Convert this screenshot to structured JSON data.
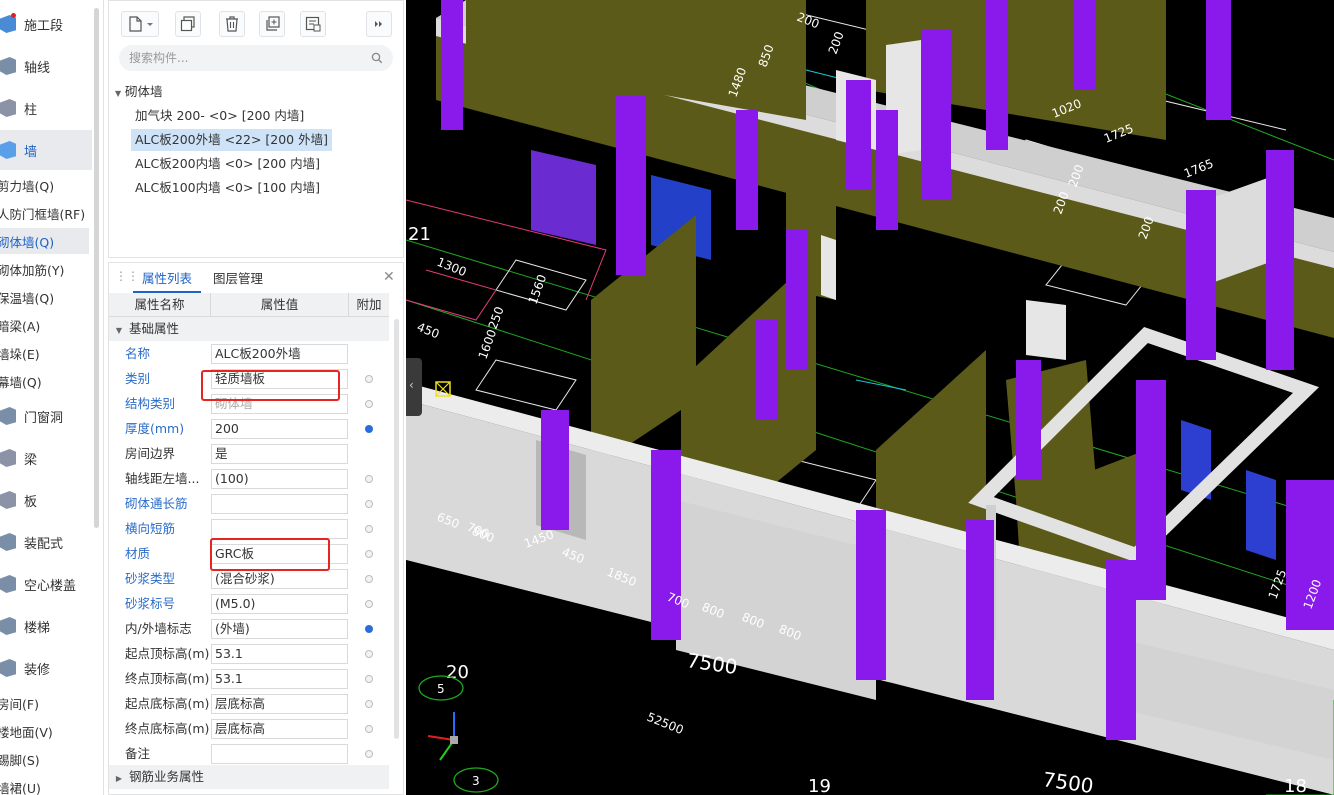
{
  "nav": {
    "items": [
      {
        "label": "施工段",
        "icon": "construction-stage-icon",
        "size": "big",
        "badge": true
      },
      {
        "label": "轴线",
        "icon": "axis-icon",
        "size": "big"
      },
      {
        "label": "柱",
        "icon": "column-icon",
        "size": "big"
      },
      {
        "label": "墙",
        "icon": "wall-icon",
        "size": "big",
        "active": true
      },
      {
        "label": "剪力墙(Q)",
        "size": "small"
      },
      {
        "label": "人防门框墙(RF)",
        "size": "small"
      },
      {
        "label": "砌体墙(Q)",
        "size": "small",
        "active": true
      },
      {
        "label": "砌体加筋(Y)",
        "size": "small"
      },
      {
        "label": "保温墙(Q)",
        "size": "small"
      },
      {
        "label": "暗梁(A)",
        "size": "small"
      },
      {
        "label": "墙垛(E)",
        "size": "small"
      },
      {
        "label": "幕墙(Q)",
        "size": "small"
      },
      {
        "label": "门窗洞",
        "icon": "door-window-icon",
        "size": "big"
      },
      {
        "label": "梁",
        "icon": "beam-icon",
        "size": "big"
      },
      {
        "label": "板",
        "icon": "slab-icon",
        "size": "big"
      },
      {
        "label": "装配式",
        "icon": "prefab-icon",
        "size": "big"
      },
      {
        "label": "空心楼盖",
        "icon": "hollow-floor-icon",
        "size": "big"
      },
      {
        "label": "楼梯",
        "icon": "stair-icon",
        "size": "big"
      },
      {
        "label": "装修",
        "icon": "decoration-icon",
        "size": "big"
      },
      {
        "label": "房间(F)",
        "size": "small"
      },
      {
        "label": "楼地面(V)",
        "size": "small"
      },
      {
        "label": "踢脚(S)",
        "size": "small"
      },
      {
        "label": "墙裙(U)",
        "size": "small"
      }
    ]
  },
  "toolbar": {
    "buttons": [
      "new-component-icon",
      "copy-icon",
      "delete-icon",
      "duplicate-layer-icon",
      "filter-icon",
      "expand-icon"
    ]
  },
  "search": {
    "placeholder": "搜索构件..."
  },
  "tree": {
    "group": "砌体墙",
    "items": [
      {
        "label": "加气块 200- <0> [200 内墙]"
      },
      {
        "label": "ALC板200外墙 <22> [200 外墙]",
        "selected": true
      },
      {
        "label": "ALC板200内墙 <0> [200 内墙]"
      },
      {
        "label": "ALC板100内墙 <0> [100 内墙]"
      }
    ]
  },
  "props": {
    "tabs": [
      "属性列表",
      "图层管理"
    ],
    "headers": {
      "name": "属性名称",
      "value": "属性值",
      "attach": "附加"
    },
    "group_basic": "基础属性",
    "group_rebar": "钢筋业务属性",
    "rows": [
      {
        "name": "名称",
        "value": "ALC板200外墙",
        "color": "blue",
        "attach": "none"
      },
      {
        "name": "类别",
        "value": "轻质墙板",
        "color": "blue",
        "attach": "off"
      },
      {
        "name": "结构类别",
        "value": "砌体墙",
        "color": "blue",
        "attach": "off",
        "grey": true
      },
      {
        "name": "厚度(mm)",
        "value": "200",
        "color": "blue",
        "attach": "on"
      },
      {
        "name": "房间边界",
        "value": "是",
        "color": "black",
        "attach": "none"
      },
      {
        "name": "轴线距左墙...",
        "value": "(100)",
        "color": "black",
        "attach": "off"
      },
      {
        "name": "砌体通长筋",
        "value": "",
        "color": "blue",
        "attach": "off"
      },
      {
        "name": "横向短筋",
        "value": "",
        "color": "blue",
        "attach": "off"
      },
      {
        "name": "材质",
        "value": "GRC板",
        "color": "blue",
        "attach": "off"
      },
      {
        "name": "砂浆类型",
        "value": "(混合砂浆)",
        "color": "blue",
        "attach": "off"
      },
      {
        "name": "砂浆标号",
        "value": "(M5.0)",
        "color": "blue",
        "attach": "off"
      },
      {
        "name": "内/外墙标志",
        "value": "(外墙)",
        "color": "black",
        "attach": "on"
      },
      {
        "name": "起点顶标高(m)",
        "value": "53.1",
        "color": "black",
        "attach": "off"
      },
      {
        "name": "终点顶标高(m)",
        "value": "53.1",
        "color": "black",
        "attach": "off"
      },
      {
        "name": "起点底标高(m)",
        "value": "层底标高",
        "color": "black",
        "attach": "off"
      },
      {
        "name": "终点底标高(m)",
        "value": "层底标高",
        "color": "black",
        "attach": "off"
      },
      {
        "name": "备注",
        "value": "",
        "color": "black",
        "attach": "off"
      }
    ]
  },
  "viewport": {
    "axis_labels": [
      "21",
      "20",
      "19",
      "18"
    ],
    "axis_bubbles": [
      "5",
      "3"
    ],
    "dimensions": [
      "7500",
      "7500",
      "52500",
      "1450",
      "1850",
      "700",
      "800",
      "800",
      "800",
      "700",
      "1020",
      "1725",
      "1765",
      "1480",
      "200",
      "850",
      "1560",
      "1600",
      "200",
      "450",
      "1300",
      "200",
      "200",
      "250",
      "1725",
      "1200",
      "200",
      "650",
      "800",
      "450"
    ]
  }
}
